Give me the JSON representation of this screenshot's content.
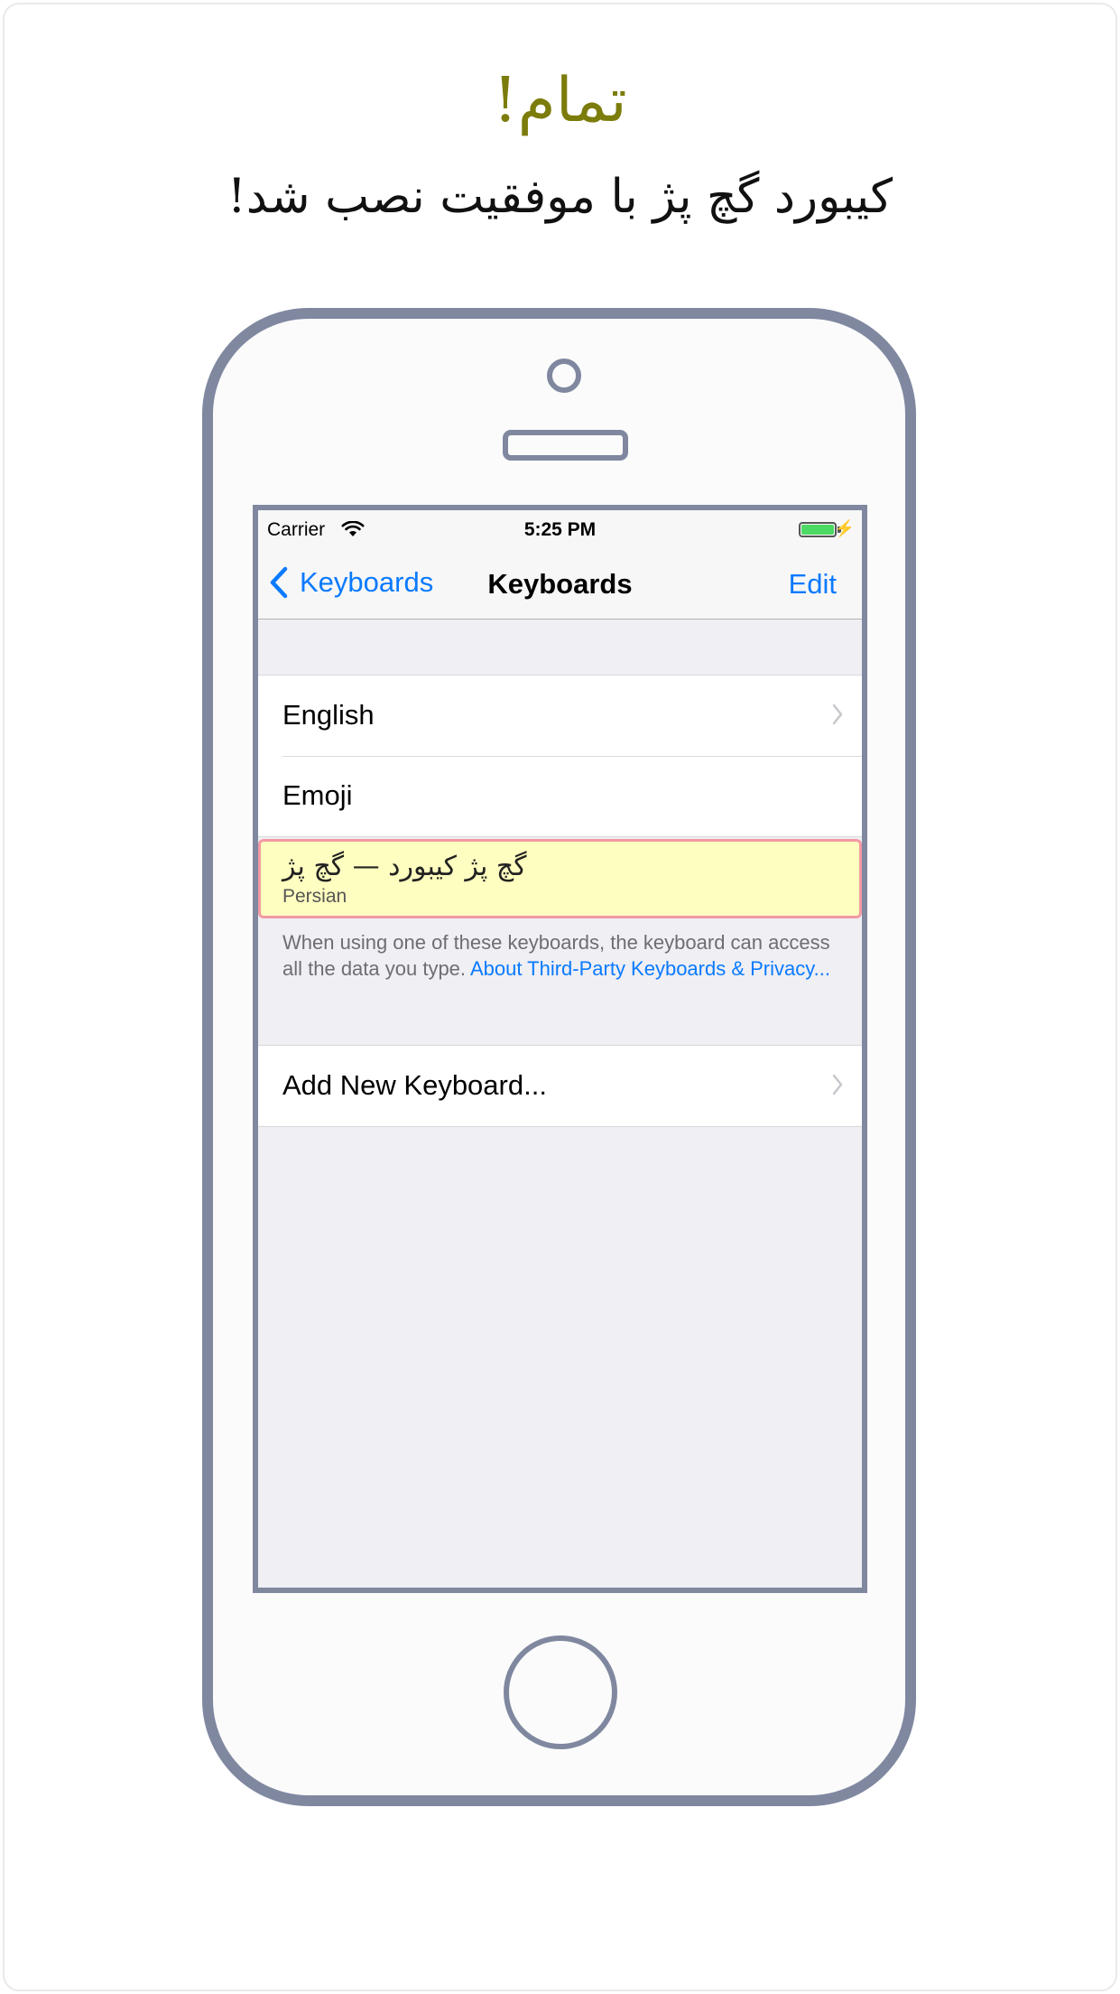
{
  "heading": {
    "title": "تمام!",
    "subtitle": "کیبورد گچ پژ با موفقیت نصب شد!"
  },
  "status_bar": {
    "carrier": "Carrier",
    "time": "5:25 PM"
  },
  "nav": {
    "back_label": "Keyboards",
    "title": "Keyboards",
    "edit_label": "Edit"
  },
  "keyboards": {
    "items": [
      {
        "label": "English",
        "has_chevron": true
      },
      {
        "label": "Emoji",
        "has_chevron": false
      }
    ],
    "third_party": {
      "name": "گچ پژ کیبورد — گچ پژ",
      "language": "Persian"
    },
    "footer_text": "When using one of these keyboards, the keyboard can access all the data you type. ",
    "footer_link": "About Third-Party Keyboards & Privacy..."
  },
  "add_keyboard": {
    "label": "Add New Keyboard..."
  },
  "colors": {
    "accent": "#0a7aff",
    "headline": "#7c7c0c",
    "device_outline": "#8088a0",
    "highlight_fill": "#fefec0",
    "highlight_border": "#f29aa3"
  }
}
